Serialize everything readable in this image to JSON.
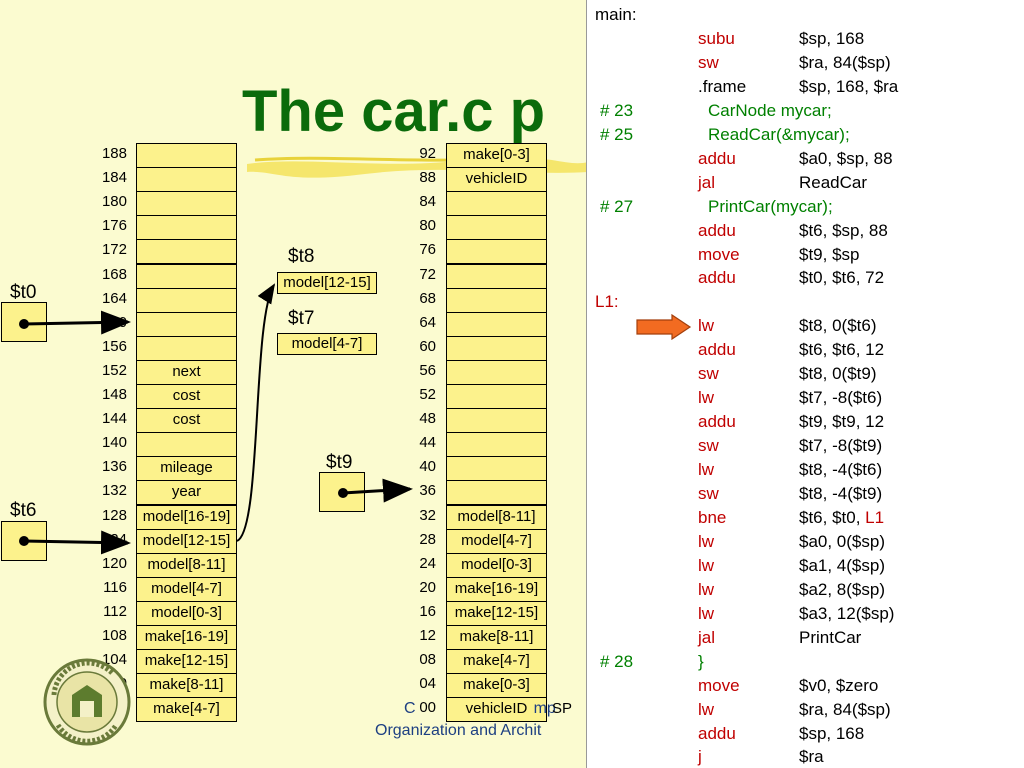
{
  "title": "The car.c p",
  "registers": {
    "t0": "$t0",
    "t6": "$t6",
    "t8": "$t8",
    "t7": "$t7",
    "t9": "$t9",
    "t8_value": "model[12-15]",
    "t7_value": "model[4-7]"
  },
  "left_stack": [
    {
      "addr": "188",
      "label": ""
    },
    {
      "addr": "184",
      "label": ""
    },
    {
      "addr": "180",
      "label": ""
    },
    {
      "addr": "176",
      "label": ""
    },
    {
      "addr": "172",
      "label": ""
    },
    {
      "addr": "168",
      "label": ""
    },
    {
      "addr": "164",
      "label": ""
    },
    {
      "addr": "160",
      "label": ""
    },
    {
      "addr": "156",
      "label": ""
    },
    {
      "addr": "152",
      "label": "next"
    },
    {
      "addr": "148",
      "label": "cost"
    },
    {
      "addr": "144",
      "label": "cost"
    },
    {
      "addr": "140",
      "label": ""
    },
    {
      "addr": "136",
      "label": "mileage"
    },
    {
      "addr": "132",
      "label": "year"
    },
    {
      "addr": "128",
      "label": "model[16-19]"
    },
    {
      "addr": "124",
      "label": "model[12-15]"
    },
    {
      "addr": "120",
      "label": "model[8-11]"
    },
    {
      "addr": "116",
      "label": "model[4-7]"
    },
    {
      "addr": "112",
      "label": "model[0-3]"
    },
    {
      "addr": "108",
      "label": "make[16-19]"
    },
    {
      "addr": "104",
      "label": "make[12-15]"
    },
    {
      "addr": "100",
      "label": "make[8-11]"
    },
    {
      "addr": "96",
      "label": "make[4-7]"
    }
  ],
  "right_stack": [
    {
      "addr": "92",
      "label": "make[0-3]"
    },
    {
      "addr": "88",
      "label": "vehicleID"
    },
    {
      "addr": "84",
      "label": ""
    },
    {
      "addr": "80",
      "label": ""
    },
    {
      "addr": "76",
      "label": ""
    },
    {
      "addr": "72",
      "label": ""
    },
    {
      "addr": "68",
      "label": ""
    },
    {
      "addr": "64",
      "label": ""
    },
    {
      "addr": "60",
      "label": ""
    },
    {
      "addr": "56",
      "label": ""
    },
    {
      "addr": "52",
      "label": ""
    },
    {
      "addr": "48",
      "label": ""
    },
    {
      "addr": "44",
      "label": ""
    },
    {
      "addr": "40",
      "label": ""
    },
    {
      "addr": "36",
      "label": ""
    },
    {
      "addr": "32",
      "label": "model[8-11]"
    },
    {
      "addr": "28",
      "label": "model[4-7]"
    },
    {
      "addr": "24",
      "label": "model[0-3]"
    },
    {
      "addr": "20",
      "label": "make[16-19]"
    },
    {
      "addr": "16",
      "label": "make[12-15]"
    },
    {
      "addr": "12",
      "label": "make[8-11]"
    },
    {
      "addr": "08",
      "label": "make[4-7]"
    },
    {
      "addr": "04",
      "label": "make[0-3]"
    },
    {
      "addr": "00",
      "label": "vehicleID"
    }
  ],
  "sp_label": "SP",
  "footer": "Organization and Archit",
  "footer_partial": "C",
  "footer_partial2": "mp",
  "code": [
    {
      "kind": "label",
      "text": "main:"
    },
    {
      "kind": "instr",
      "op": "subu",
      "args": "$sp, 168"
    },
    {
      "kind": "instr",
      "op": "sw",
      "args": "$ra, 84($sp)"
    },
    {
      "kind": "dir",
      "op": ".frame",
      "args": "$sp, 168, $ra"
    },
    {
      "kind": "comment",
      "num": "#  23",
      "text": "CarNode mycar;"
    },
    {
      "kind": "comment",
      "num": "#  25",
      "text": "ReadCar(&mycar);"
    },
    {
      "kind": "instr",
      "op": "addu",
      "args": "$a0, $sp, 88"
    },
    {
      "kind": "instr",
      "op": "jal",
      "args": "ReadCar"
    },
    {
      "kind": "comment",
      "num": "#  27",
      "text": "PrintCar(mycar);"
    },
    {
      "kind": "instr",
      "op": "addu",
      "args": "$t6, $sp, 88"
    },
    {
      "kind": "instr",
      "op": "move",
      "args": "$t9, $sp"
    },
    {
      "kind": "instr",
      "op": "addu",
      "args": "$t0, $t6, 72"
    },
    {
      "kind": "looplabel",
      "text": "L1:"
    },
    {
      "kind": "instr",
      "op": "lw",
      "args": "$t8, 0($t6)"
    },
    {
      "kind": "instr",
      "op": "addu",
      "args": "$t6, $t6, 12"
    },
    {
      "kind": "instr",
      "op": "sw",
      "args": "$t8, 0($t9)"
    },
    {
      "kind": "instr",
      "op": "lw",
      "args": "$t7, -8($t6)"
    },
    {
      "kind": "instr",
      "op": "addu",
      "args": "$t9, $t9, 12"
    },
    {
      "kind": "instr",
      "op": "sw",
      "args": "$t7, -8($t9)"
    },
    {
      "kind": "instr",
      "op": "lw",
      "args": "$t8, -4($t6)"
    },
    {
      "kind": "instr",
      "op": "sw",
      "args": "$t8, -4($t9)"
    },
    {
      "kind": "branch",
      "op": "bne",
      "args": "$t6, $t0, ",
      "target": "L1"
    },
    {
      "kind": "instr",
      "op": "lw",
      "args": "$a0, 0($sp)"
    },
    {
      "kind": "instr",
      "op": "lw",
      "args": "$a1, 4($sp)"
    },
    {
      "kind": "instr",
      "op": "lw",
      "args": "$a2, 8($sp)"
    },
    {
      "kind": "instr",
      "op": "lw",
      "args": "$a3, 12($sp)"
    },
    {
      "kind": "instr",
      "op": "jal",
      "args": "PrintCar"
    },
    {
      "kind": "brace",
      "num": "#  28",
      "text": "}"
    },
    {
      "kind": "instr",
      "op": "move",
      "args": "$v0, $zero"
    },
    {
      "kind": "instr",
      "op": "lw",
      "args": "$ra, 84($sp)"
    },
    {
      "kind": "instr",
      "op": "addu",
      "args": "$sp, 168"
    },
    {
      "kind": "instr",
      "op": "j",
      "args": "$ra"
    }
  ],
  "colors": {
    "title": "#0b6b0b",
    "cell": "#fcf28c",
    "background": "#fbfbd0",
    "opcode": "#c00000",
    "comment": "#008000",
    "arrow": "#f26b21"
  }
}
